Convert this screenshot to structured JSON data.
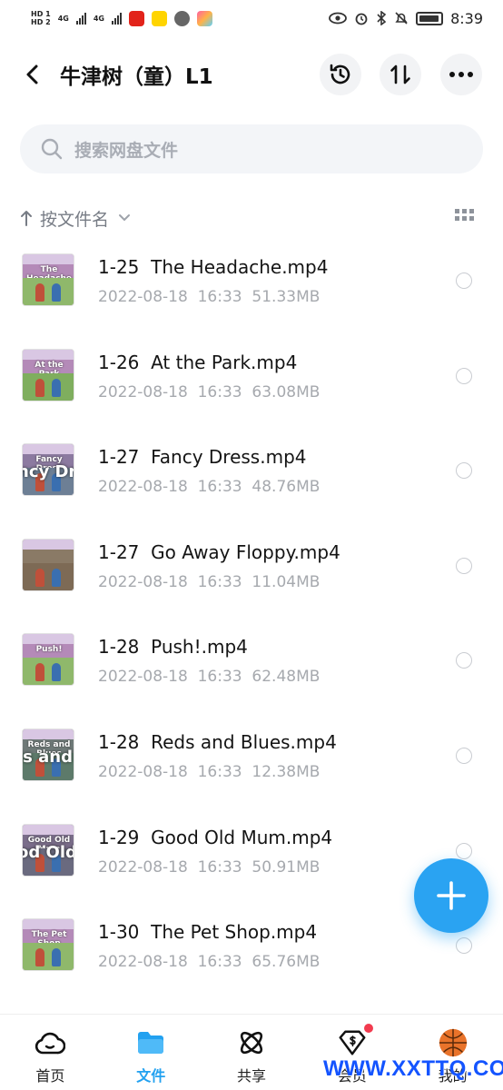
{
  "status_bar": {
    "sim1": "HD 1",
    "sim2": "HD 2",
    "net1": "4G",
    "net2": "4G",
    "clock": "8:39"
  },
  "header": {
    "title": "牛津树（童）L1"
  },
  "search": {
    "placeholder": "搜索网盘文件"
  },
  "sort": {
    "label": "按文件名"
  },
  "files": [
    {
      "name": "1-25  The Headache.mp4",
      "date": "2022-08-18",
      "time": "16:33",
      "size": "51.33MB",
      "thumb_title": "The Headache",
      "thumb_color": "#b48ab8"
    },
    {
      "name": "1-26  At the Park.mp4",
      "date": "2022-08-18",
      "time": "16:33",
      "size": "63.08MB",
      "thumb_title": "At the Park",
      "thumb_color": "#b48ab8"
    },
    {
      "name": "1-27  Fancy Dress.mp4",
      "date": "2022-08-18",
      "time": "16:33",
      "size": "48.76MB",
      "thumb_title": "Fancy Dress",
      "thumb_color": "#8c7aa0"
    },
    {
      "name": "1-27  Go Away Floppy.mp4",
      "date": "2022-08-18",
      "time": "16:33",
      "size": "11.04MB",
      "thumb_title": "",
      "thumb_color": "#8a7a66"
    },
    {
      "name": "1-28  Push!.mp4",
      "date": "2022-08-18",
      "time": "16:33",
      "size": "62.48MB",
      "thumb_title": "Push!",
      "thumb_color": "#b48ab8"
    },
    {
      "name": "1-28  Reds and Blues.mp4",
      "date": "2022-08-18",
      "time": "16:33",
      "size": "12.38MB",
      "thumb_title": "Reds and Blues",
      "thumb_color": "#6f7a78"
    },
    {
      "name": "1-29  Good Old Mum.mp4",
      "date": "2022-08-18",
      "time": "16:33",
      "size": "50.91MB",
      "thumb_title": "Good Old Mum",
      "thumb_color": "#7a6d8a"
    },
    {
      "name": "1-30  The Pet Shop.mp4",
      "date": "2022-08-18",
      "time": "16:33",
      "size": "65.76MB",
      "thumb_title": "The Pet Shop",
      "thumb_color": "#b48ab8"
    }
  ],
  "thumb_big_text": {
    "2": "ncy Dre",
    "5": "ls and B",
    "6": "od Old M"
  },
  "bottom_nav": [
    {
      "label": "首页",
      "icon": "cloud-home-icon",
      "active": false
    },
    {
      "label": "文件",
      "icon": "folder-icon",
      "active": true
    },
    {
      "label": "共享",
      "icon": "share-atom-icon",
      "active": false
    },
    {
      "label": "会员",
      "icon": "vip-diamond-icon",
      "active": false
    },
    {
      "label": "我的",
      "icon": "avatar-icon",
      "active": false
    }
  ],
  "watermark": "WWW.XXTTQ.COM",
  "colors": {
    "accent": "#22a1f0",
    "fab": "#2aa3f2",
    "badge": "#f23b4f",
    "watermark": "#1454ff"
  }
}
